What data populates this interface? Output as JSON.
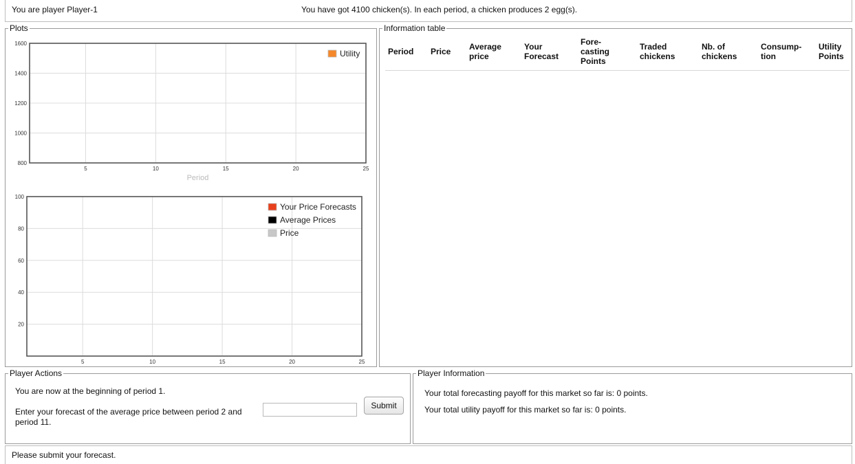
{
  "header": {
    "player_text": "You are player Player-1",
    "holdings_text": "You have got 4100 chicken(s). In each period, a chicken produces 2 egg(s)."
  },
  "plots": {
    "legend_title": "Plots",
    "utility_chart": {
      "y_ticks": [
        "1600",
        "1400",
        "1200",
        "1000",
        "800"
      ],
      "x_ticks": [
        "5",
        "10",
        "15",
        "20",
        "25"
      ],
      "x_axis_label": "Period",
      "legend": [
        {
          "label": "Utility",
          "color": "#f5882a"
        }
      ]
    },
    "price_chart": {
      "y_ticks": [
        "100",
        "80",
        "60",
        "40",
        "20"
      ],
      "x_ticks": [
        "5",
        "10",
        "15",
        "20",
        "25"
      ],
      "legend": [
        {
          "label": "Your Price Forecasts",
          "color": "#e8401c"
        },
        {
          "label": "Average Prices",
          "color": "#000000"
        },
        {
          "label": "Price",
          "color": "#c8c8c8"
        }
      ]
    }
  },
  "chart_data": [
    {
      "type": "line",
      "x": [],
      "series": [
        {
          "name": "Utility",
          "values": []
        }
      ],
      "xlabel": "Period",
      "ylabel": "",
      "xlim": [
        1,
        25
      ],
      "ylim": [
        800,
        1600
      ],
      "x_ticks": [
        5,
        10,
        15,
        20,
        25
      ],
      "y_ticks": [
        800,
        1000,
        1200,
        1400,
        1600
      ],
      "grid": true,
      "legend": "top-right"
    },
    {
      "type": "line",
      "x": [],
      "series": [
        {
          "name": "Your Price Forecasts",
          "values": []
        },
        {
          "name": "Average Prices",
          "values": []
        },
        {
          "name": "Price",
          "values": []
        }
      ],
      "xlabel": "",
      "ylabel": "",
      "xlim": [
        1,
        25
      ],
      "ylim": [
        0,
        100
      ],
      "x_ticks": [
        5,
        10,
        15,
        20,
        25
      ],
      "y_ticks": [
        20,
        40,
        60,
        80,
        100
      ],
      "grid": true,
      "legend": "top-right"
    }
  ],
  "info_table": {
    "legend_title": "Information table",
    "columns": [
      [
        "Period"
      ],
      [
        "Price"
      ],
      [
        "Average",
        "price"
      ],
      [
        "Your",
        "Forecast"
      ],
      [
        "Fore-",
        "casting",
        "Points"
      ],
      [
        "Traded",
        "chickens"
      ],
      [
        "Nb. of",
        "chickens"
      ],
      [
        "Consump-",
        "tion"
      ],
      [
        "Utility",
        "Points"
      ]
    ],
    "rows": []
  },
  "player_actions": {
    "legend_title": "Player Actions",
    "period_text": "You are now at the beginning of period 1.",
    "forecast_prompt": "Enter your forecast of the average price between period 2 and period 11.",
    "forecast_value": "",
    "submit_label": "Submit"
  },
  "player_information": {
    "legend_title": "Player Information",
    "forecasting_payoff_text": "Your total forecasting payoff for this market so far is: 0 points.",
    "utility_payoff_text": "Your total utility payoff for this market so far is: 0 points."
  },
  "status": {
    "message": "Please submit your forecast."
  }
}
